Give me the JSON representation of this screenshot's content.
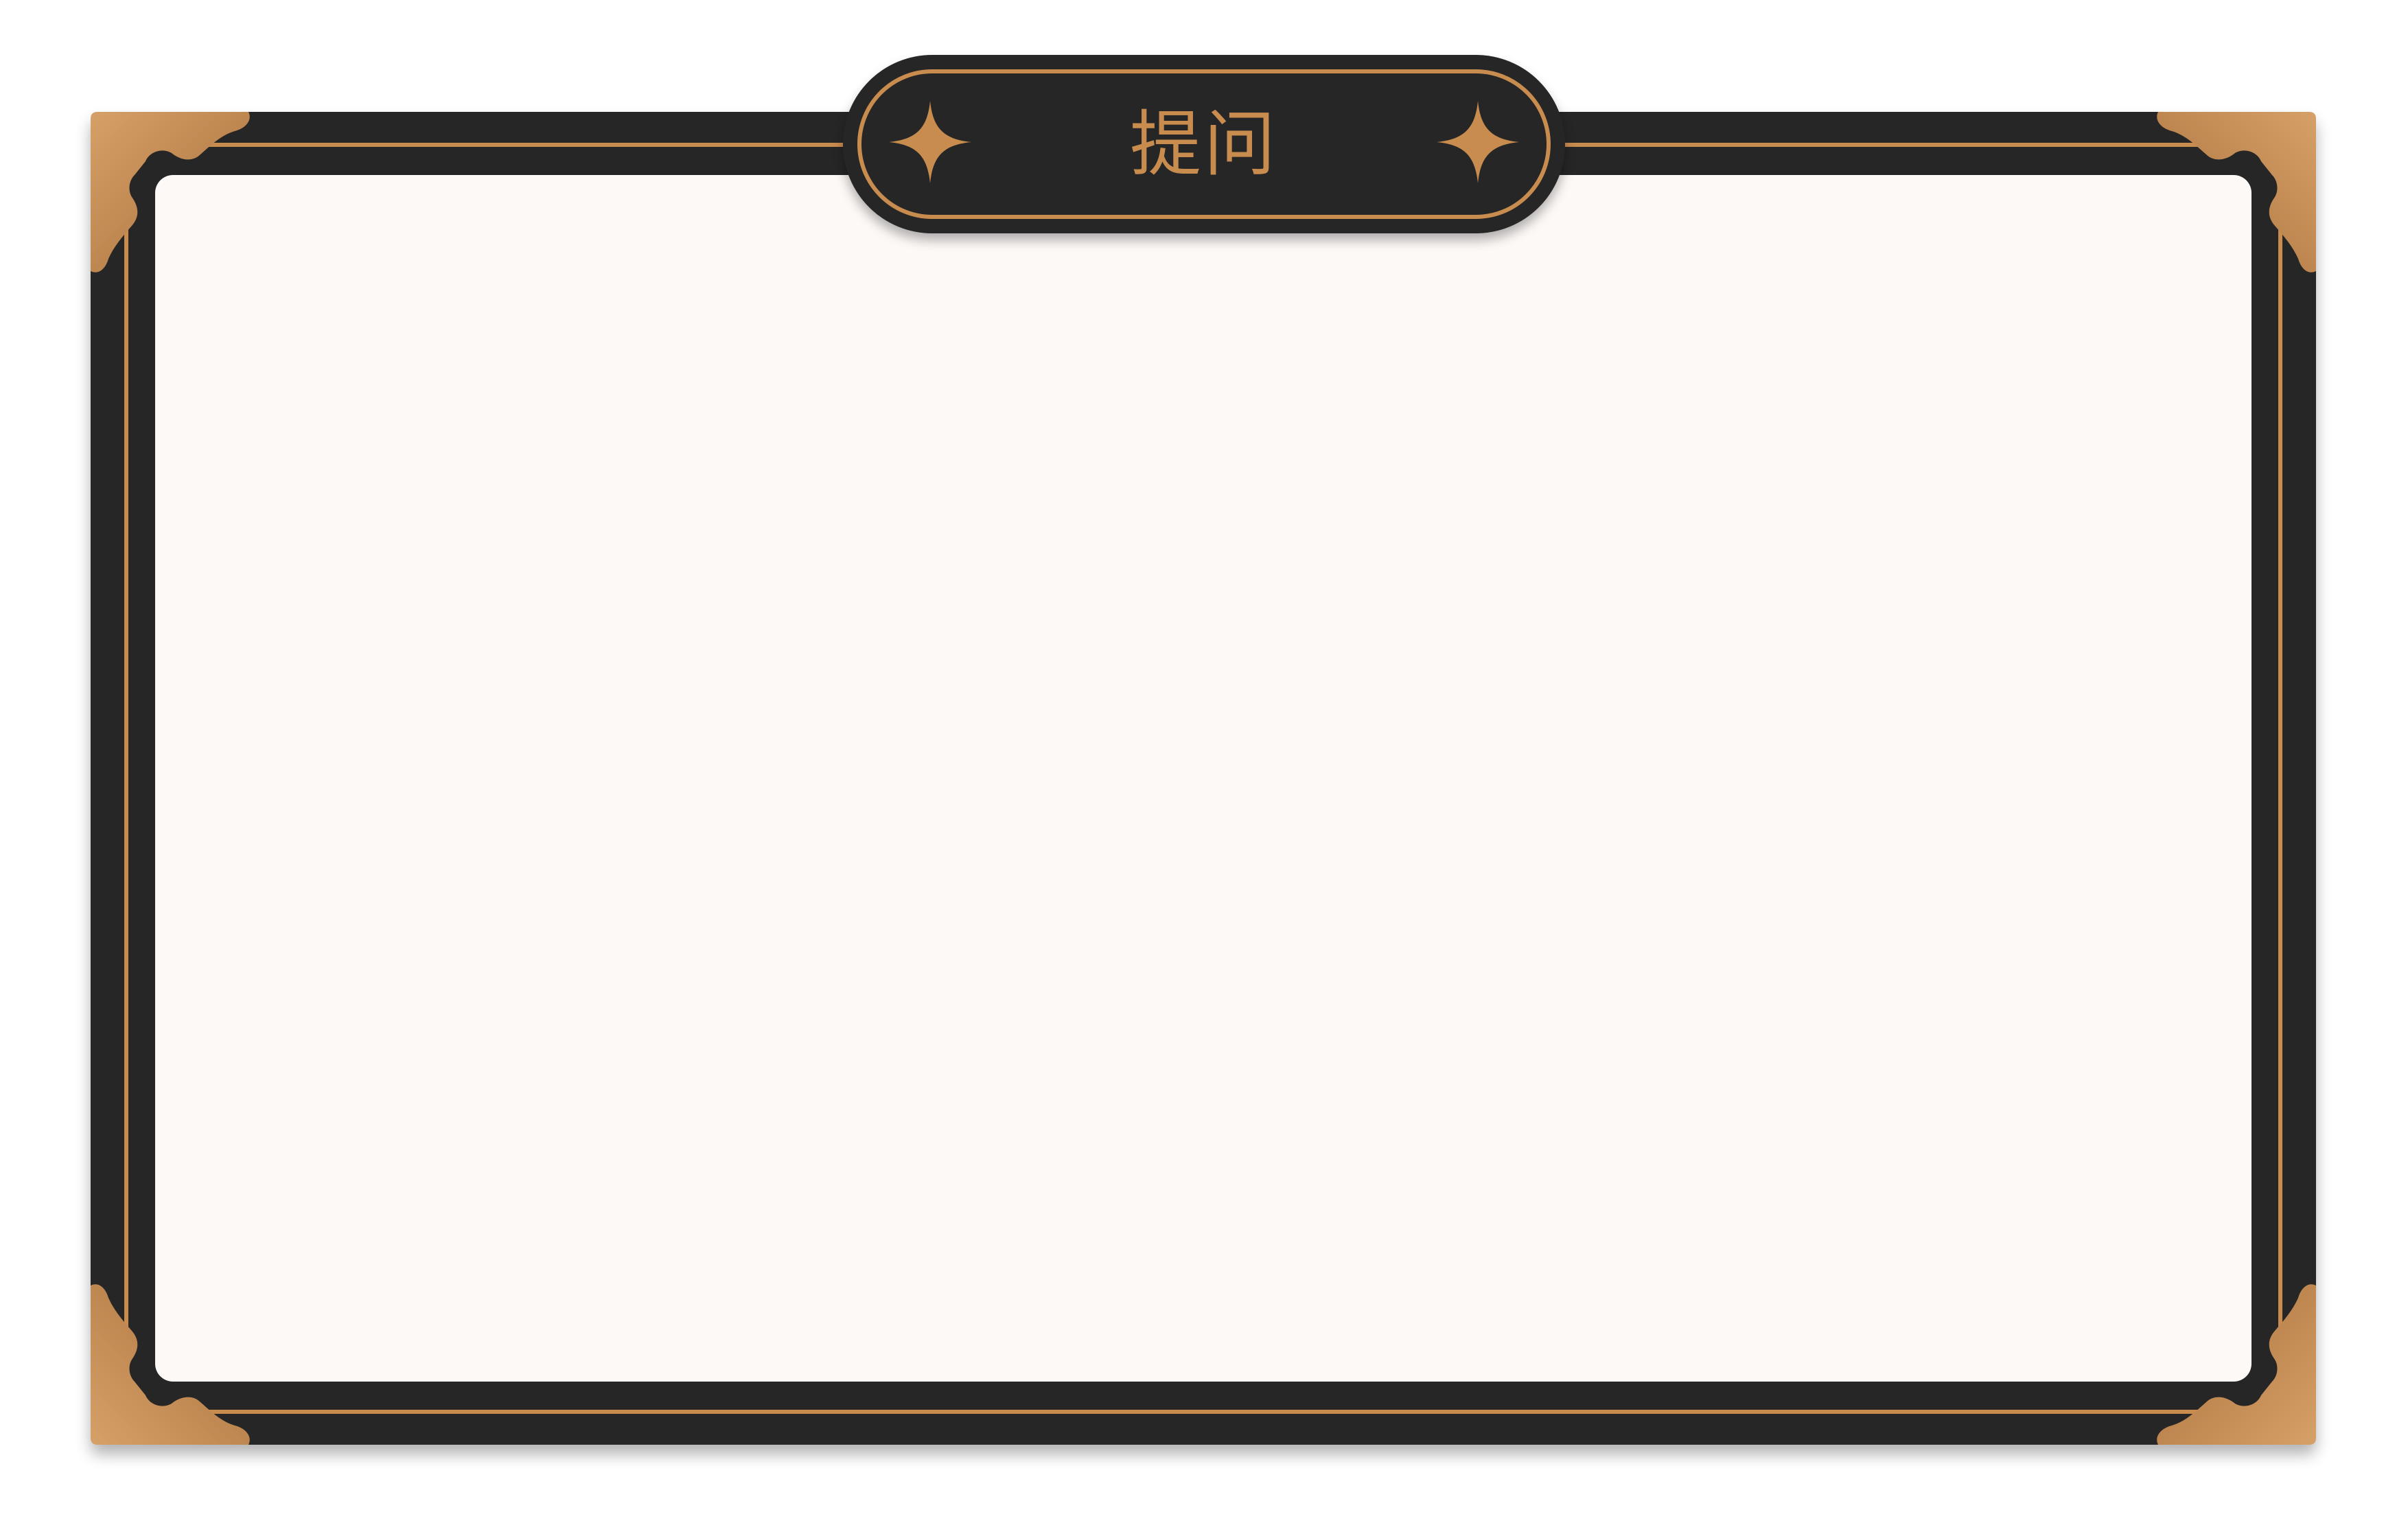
{
  "dialog": {
    "title": "提问"
  },
  "icons": {
    "title_left": "sparkle-icon",
    "title_right": "sparkle-icon",
    "corners": "corner-ornament-icon"
  },
  "colors": {
    "frame": "#262626",
    "gold": "#c98c4f",
    "panel": "#fdf9f7",
    "page": "#ffffff"
  }
}
